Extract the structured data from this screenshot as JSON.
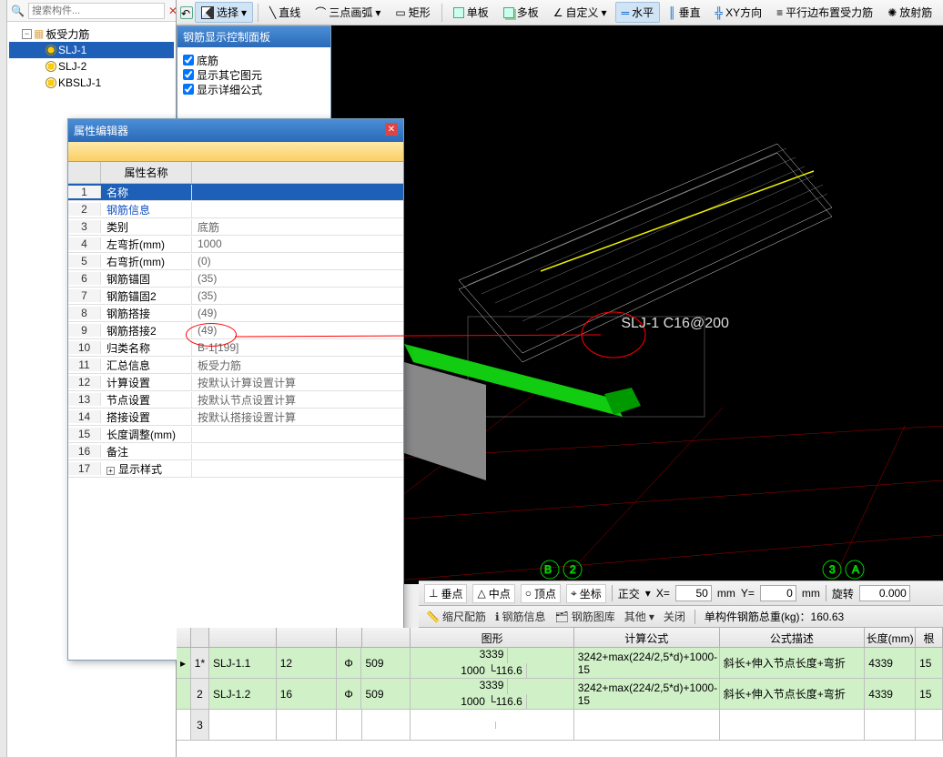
{
  "toolbar": {
    "select": "选择",
    "line": "直线",
    "arc3pt": "三点画弧",
    "rect": "矩形",
    "single": "单板",
    "multi": "多板",
    "custom": "自定义",
    "horiz": "水平",
    "vert": "垂直",
    "xy": "XY方向",
    "parallel": "平行边布置受力筋",
    "radial": "放射筋"
  },
  "search_placeholder": "搜索构件...",
  "tree": {
    "root": "板受力筋",
    "items": [
      "SLJ-1",
      "SLJ-2",
      "KBSLJ-1"
    ]
  },
  "ctrl_panel": {
    "title": "钢筋显示控制面板",
    "opts": [
      "底筋",
      "显示其它图元",
      "显示详细公式"
    ]
  },
  "prop_panel": {
    "title": "属性编辑器",
    "hdr_num": "",
    "hdr_name": "属性名称",
    "hdr_val": "",
    "rows": [
      {
        "n": "1",
        "name": "名称",
        "val": "",
        "sel": true
      },
      {
        "n": "2",
        "name": "钢筋信息",
        "val": "",
        "link": true
      },
      {
        "n": "3",
        "name": "类别",
        "val": "底筋"
      },
      {
        "n": "4",
        "name": "左弯折(mm)",
        "val": "1000"
      },
      {
        "n": "5",
        "name": "右弯折(mm)",
        "val": "(0)"
      },
      {
        "n": "6",
        "name": "钢筋锚固",
        "val": "(35)"
      },
      {
        "n": "7",
        "name": "钢筋锚固2",
        "val": "(35)"
      },
      {
        "n": "8",
        "name": "钢筋搭接",
        "val": "(49)"
      },
      {
        "n": "9",
        "name": "钢筋搭接2",
        "val": "(49)"
      },
      {
        "n": "10",
        "name": "归类名称",
        "val": "B-1[199]"
      },
      {
        "n": "11",
        "name": "汇总信息",
        "val": "板受力筋"
      },
      {
        "n": "12",
        "name": "计算设置",
        "val": "按默认计算设置计算"
      },
      {
        "n": "13",
        "name": "节点设置",
        "val": "按默认节点设置计算"
      },
      {
        "n": "14",
        "name": "搭接设置",
        "val": "按默认搭接设置计算"
      },
      {
        "n": "15",
        "name": "长度调整(mm)",
        "val": ""
      },
      {
        "n": "16",
        "name": "备注",
        "val": ""
      },
      {
        "n": "17",
        "name": "显示样式",
        "val": "",
        "expand": true
      }
    ]
  },
  "viewport_label": "SLJ-1  C16@200",
  "status": {
    "btns": [
      "垂点",
      "中点",
      "顶点",
      "坐标"
    ],
    "orth": "正交",
    "xl": "X=",
    "xv": "50",
    "xu": "mm",
    "yl": "Y=",
    "yv": "0",
    "yu": "mm",
    "rot": "旋转",
    "rotv": "0.000"
  },
  "info": {
    "a": "缩尺配筋",
    "b": "钢筋信息",
    "c": "钢筋图库",
    "d": "其他",
    "e": "关闭",
    "weight": "单构件钢筋总重(kg)：160.63"
  },
  "table": {
    "hdr": [
      "",
      "",
      "",
      "",
      "",
      "",
      "图形",
      "计算公式",
      "公式描述",
      "长度(mm)",
      "根"
    ],
    "rows": [
      {
        "n": "1*",
        "name": "SLJ-1.1",
        "d": "12",
        "sym": "Φ",
        "len": "509",
        "shape_t": "3339",
        "shape_b": "1000 └116.6",
        "formula": "3242+max(224/2,5*d)+1000-15",
        "desc": "斜长+伸入节点长度+弯折",
        "L": "4339",
        "qty": "15",
        "green": true
      },
      {
        "n": "2",
        "name": "SLJ-1.2",
        "d": "16",
        "sym": "Φ",
        "len": "509",
        "shape_t": "3339",
        "shape_b": "1000 └116.6",
        "formula": "3242+max(224/2,5*d)+1000-15",
        "desc": "斜长+伸入节点长度+弯折",
        "L": "4339",
        "qty": "15",
        "green": true
      },
      {
        "n": "3",
        "name": "",
        "d": "",
        "sym": "",
        "len": "",
        "shape_t": "",
        "shape_b": "",
        "formula": "",
        "desc": "",
        "L": "",
        "qty": ""
      }
    ]
  }
}
